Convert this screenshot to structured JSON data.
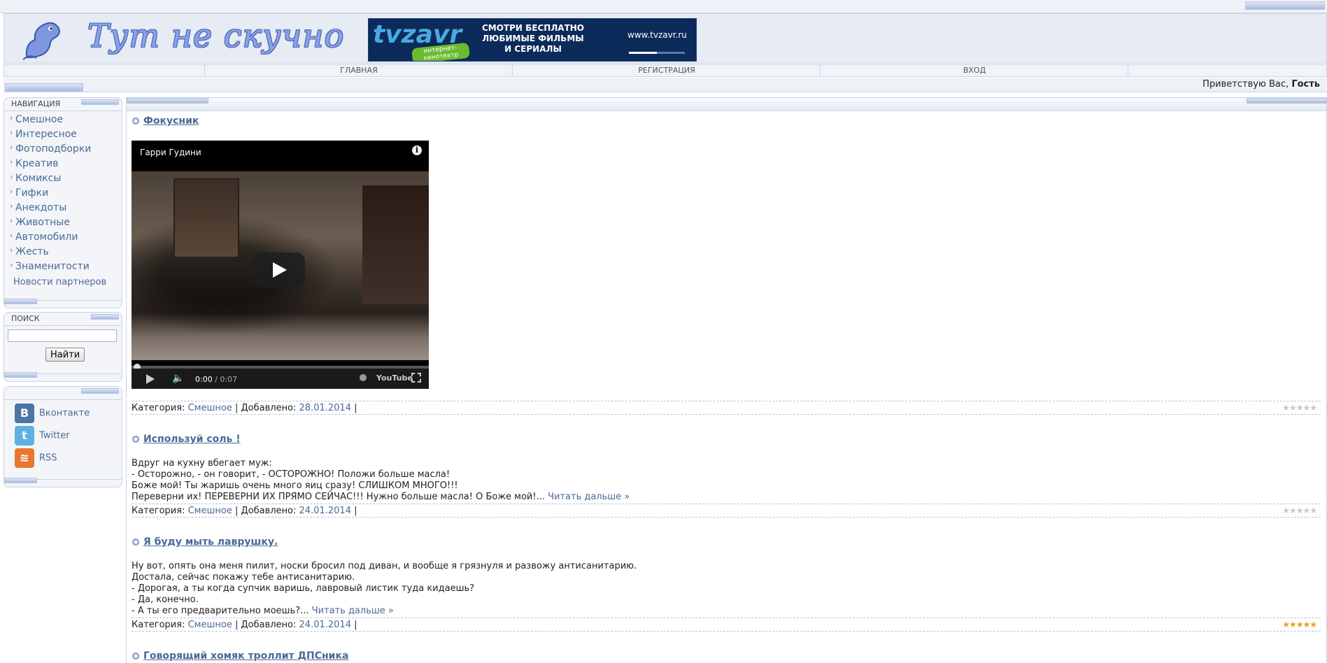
{
  "header": {
    "logo_text": "Тут не скучно",
    "ad": {
      "brand": "tvzavr",
      "tag": "интернет-кинотеатр",
      "slogan": "СМОТРИ БЕСПЛАТНО ЛЮБИМЫЕ ФИЛЬМЫ И СЕРИАЛЫ",
      "url": "www.tvzavr.ru"
    }
  },
  "menu": {
    "items": [
      {
        "label": "Главная"
      },
      {
        "label": "Регистрация"
      },
      {
        "label": "Вход"
      }
    ]
  },
  "welcome": {
    "prefix": "Приветствую Вас,",
    "user": "Гость"
  },
  "sidebar": {
    "nav_title": "Навигация",
    "nav_items": [
      {
        "label": "Смешное"
      },
      {
        "label": "Интересное"
      },
      {
        "label": "Фотоподборки"
      },
      {
        "label": "Креатив"
      },
      {
        "label": "Комиксы"
      },
      {
        "label": "Гифки"
      },
      {
        "label": "Анекдоты"
      },
      {
        "label": "Животные"
      },
      {
        "label": "Автомобили"
      },
      {
        "label": "Жесть"
      },
      {
        "label": "Знаменитости"
      }
    ],
    "partners": "Новости партнеров",
    "search_title": "Поиск",
    "search_value": "",
    "search_button": "Найти",
    "social": [
      {
        "label": "Вконтакте",
        "icon": "vk-icon",
        "color": "#4c75a3",
        "glyph": "B"
      },
      {
        "label": "Twitter",
        "icon": "twitter-icon",
        "color": "#5fb0e0",
        "glyph": "t"
      },
      {
        "label": "RSS",
        "icon": "rss-icon",
        "color": "#e8772e",
        "glyph": "≋"
      }
    ]
  },
  "posts": [
    {
      "title": "Фокусник",
      "video": {
        "title": "Гарри Гудини",
        "time_current": "0:00",
        "time_total": "/ 0:07",
        "youtube": "YouTube"
      },
      "category_label": "Категория:",
      "category": "Смешное",
      "added_label": "| Добавлено:",
      "date": "28.01.2014",
      "tail": "|",
      "rating_stars": 0
    },
    {
      "title": "Используй соль !",
      "text": "Вдруг на кухну вбегает муж:\n- Осторожно, - он говорит, - ОСТОРОЖНО! Положи больше масла!\nБоже мой! Ты жаришь очень много яиц сразу! СЛИШКОМ МНОГО!!!\nПереверни их! ПЕРЕВЕРНИ ИХ ПРЯМО СЕЙЧАС!!! Нужно больше масла! О Боже мой!... ",
      "read_more": "Читать дальше »",
      "category_label": "Категория:",
      "category": "Смешное",
      "added_label": "| Добавлено:",
      "date": "24.01.2014",
      "tail": "|",
      "rating_stars": 0
    },
    {
      "title": "Я буду мыть лаврушку.",
      "text": "Ну вот, опять она меня пилит, носки бросил под диван, и вообще я грязнуля и развожу антисанитарию.\nДостала, сейчас покажу тебе антисанитарию.\n- Дорогая, а ты когда супчик варишь, лавровый листик туда кидаешь?\n- Да, конечно.\n- А ты его предварительно моешь?... ",
      "read_more": "Читать дальше »",
      "category_label": "Категория:",
      "category": "Смешное",
      "added_label": "| Добавлено:",
      "date": "24.01.2014",
      "tail": "|",
      "rating_stars": 5
    },
    {
      "title": "Говорящий хомяк троллит ДПСника"
    }
  ],
  "colors": {
    "link": "#4a6a96",
    "accent": "#8aa2e8",
    "star_on": "#e8a317",
    "star_off": "#c8c8c8"
  }
}
